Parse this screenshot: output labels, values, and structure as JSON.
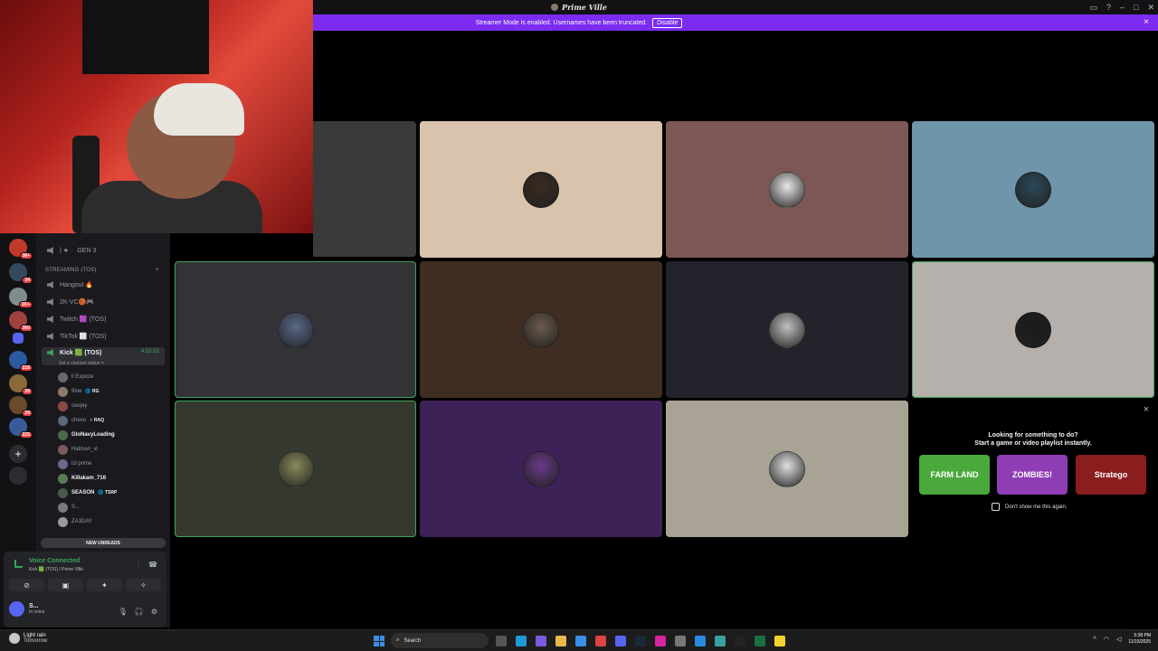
{
  "titlebar": {
    "app_name": "Prime Ville"
  },
  "banner": {
    "message": "Streamer Mode is enabled. Usernames have been truncated.",
    "disable_label": "Disable",
    "close_icon": "×"
  },
  "servers": [
    {
      "badge": "38+"
    },
    {
      "badge": "34"
    },
    {
      "badge": "1K+"
    },
    {
      "badge": "360"
    },
    {
      "badge": ""
    },
    {
      "badge": "218"
    },
    {
      "badge": "29"
    },
    {
      "badge": "29"
    },
    {
      "badge": "225"
    }
  ],
  "sidebar": {
    "top_channel": "GEN 3",
    "top_channel_prefix": "| ★ ·",
    "category": "STREAMING (TOS)",
    "channels": [
      {
        "label": "Hangout 🔥"
      },
      {
        "label": "2K-VC🏀🎮"
      },
      {
        "label": "Twitch 🟪 (TOS)"
      },
      {
        "label": "TikTok ⬜ (TOS)"
      }
    ],
    "active_channel": {
      "label": "Kick 🟩 (TOS)",
      "timer": "4:52:52",
      "status": "Set a channel status ✏"
    },
    "members": [
      {
        "name": "ll Expoze",
        "tag": "",
        "bold": false
      },
      {
        "name": "9ine",
        "tag": "🌐 RG",
        "bold": false
      },
      {
        "name": "ceejay",
        "tag": "",
        "bold": false
      },
      {
        "name": "chexo",
        "tag": "⚡ RAQ",
        "bold": false
      },
      {
        "name": "GloNavyLoading",
        "tag": "",
        "bold": true
      },
      {
        "name": "Hatman_vl",
        "tag": "",
        "bold": false
      },
      {
        "name": "lzl prime",
        "tag": "",
        "bold": false
      },
      {
        "name": "Killakam_716",
        "tag": "",
        "bold": true
      },
      {
        "name": "SEASON",
        "tag": "🌐 TSRP",
        "bold": true
      },
      {
        "name": "S...",
        "tag": "",
        "bold": false
      },
      {
        "name": "ZA3DAY",
        "tag": "",
        "bold": false
      }
    ],
    "new_unreads": "NEW UNREADS"
  },
  "voice_panel": {
    "status": "Voice Connected",
    "channel": "Kick 🟩 (TOS) / Prime Ville",
    "user_name": "S...",
    "user_status": "In voice"
  },
  "tiles": [
    {
      "bg": "#d9c3ac",
      "avatar": "#3a2a20",
      "speaking": false
    },
    {
      "bg": "#7d5755",
      "avatar": "#e8e8e8",
      "speaking": false
    },
    {
      "bg": "#6e95aa",
      "avatar": "#2a4a5a",
      "speaking": false
    },
    {
      "bg": "#323237",
      "avatar": "#5a6a8a",
      "speaking": true
    },
    {
      "bg": "#402d22",
      "avatar": "#6b5a4a",
      "speaking": false
    },
    {
      "bg": "#22232b",
      "avatar": "#c0c0c0",
      "speaking": false
    },
    {
      "bg": "#b5b0ac",
      "avatar": "#1a1a1a",
      "speaking": true
    },
    {
      "bg": "#35382f",
      "avatar": "#8a8a5a",
      "speaking": true
    },
    {
      "bg": "#3c2256",
      "avatar": "#6a3a8a",
      "speaking": false
    },
    {
      "bg": "#a9a396",
      "avatar": "#e0e0e0",
      "speaking": false
    }
  ],
  "activity": {
    "heading": "Looking for something to do?",
    "subheading": "Start a game or video playlist instantly.",
    "games": [
      {
        "title": "FARM LAND",
        "color": "#4aa83c"
      },
      {
        "title": "ZOMBIES!",
        "color": "#8e3db5"
      },
      {
        "title": "Stratego",
        "color": "#8a1d1d"
      }
    ],
    "dont_show": "Don't show me this again.",
    "close_icon": "×"
  },
  "taskbar": {
    "weather": "Light rain",
    "weather_sub": "Tomorrow",
    "search_placeholder": "Search",
    "time": "5:38 PM",
    "date": "11/15/2025"
  }
}
